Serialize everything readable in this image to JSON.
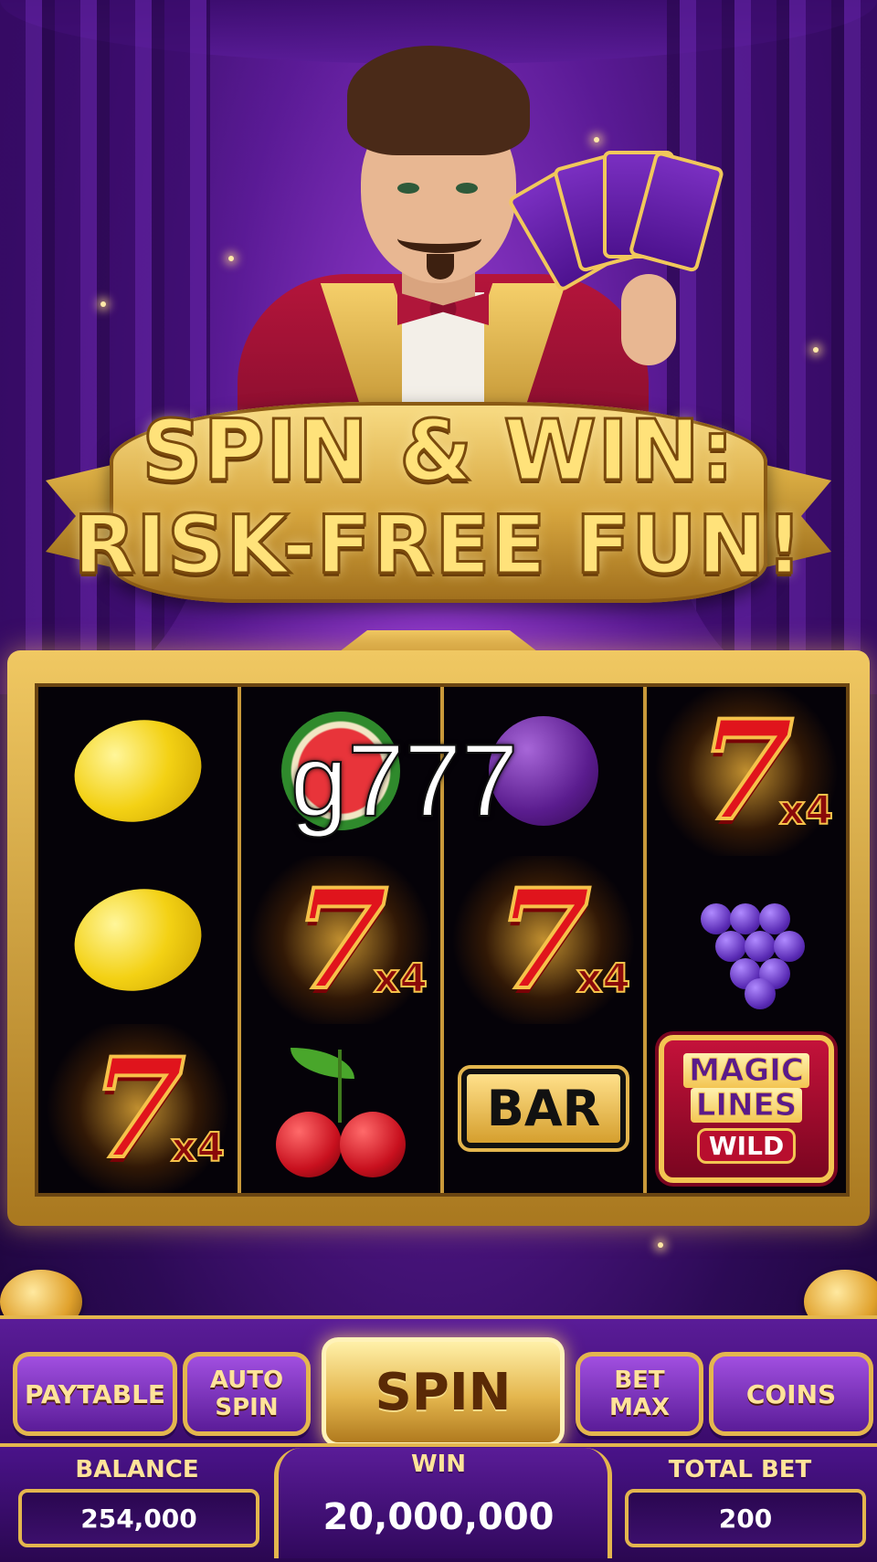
{
  "banner": {
    "line1": "SPIN & WIN:",
    "line2": "RISK-FREE FUN!"
  },
  "overlay": {
    "text": "g777"
  },
  "reels": [
    [
      "lemon",
      "lemon",
      "seven-x4"
    ],
    [
      "watermelon",
      "seven-x4",
      "cherry"
    ],
    [
      "plum",
      "seven-x4",
      "bar"
    ],
    [
      "seven-x4",
      "grapes",
      "magic-lines-wild"
    ]
  ],
  "symbols": {
    "multiplier": "x4",
    "bar_label": "BAR",
    "magic_line1": "MAGIC",
    "magic_line2": "LINES",
    "wild_label": "WILD"
  },
  "controls": {
    "paytable": "PAYTABLE",
    "auto_spin_1": "AUTO",
    "auto_spin_2": "SPIN",
    "spin": "SPIN",
    "bet_max_1": "BET",
    "bet_max_2": "MAX",
    "coins": "COINS"
  },
  "stats": {
    "balance_label": "BALANCE",
    "balance_value": "254,000",
    "win_label": "WIN",
    "win_value": "20,000,000",
    "total_bet_label": "TOTAL BET",
    "total_bet_value": "200"
  },
  "colors": {
    "accent_gold": "#e4b64e",
    "background_purple": "#5a1c98",
    "seven_red": "#e0141c"
  }
}
